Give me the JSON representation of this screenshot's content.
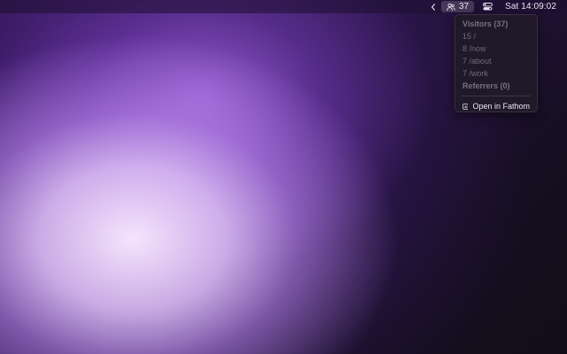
{
  "menubar": {
    "chevron_icon": "chevron-left-icon",
    "fathom_icon": "visitors-icon",
    "visitor_count": "37",
    "control_center_icon": "control-center-icon",
    "clock": "Sat 14:09:02"
  },
  "dropdown": {
    "visitors_header": "Visitors (37)",
    "pages": [
      {
        "label": "15 /"
      },
      {
        "label": "8 /now"
      },
      {
        "label": "7 /about"
      },
      {
        "label": "7 /work"
      }
    ],
    "referrers_header": "Referrers (0)",
    "open_icon": "chart-icon",
    "open_label": "Open in Fathom"
  },
  "colors": {
    "menubar_text": "#e9e4f2",
    "menu_background": "#201a2a",
    "disabled_text": "#6f6a79",
    "wallpaper_highlight": "#f8e8ff",
    "wallpaper_purple": "#8a4fd0"
  }
}
